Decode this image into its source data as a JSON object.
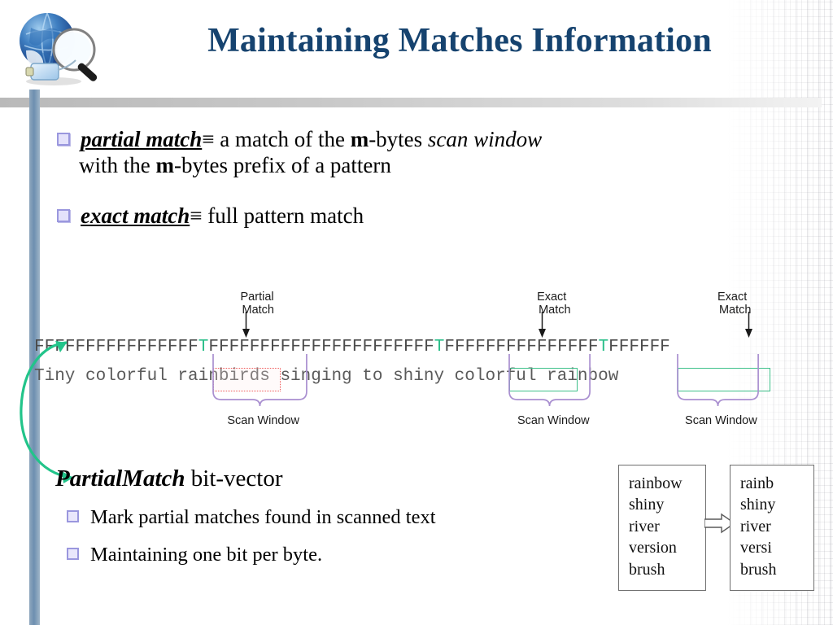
{
  "slide": {
    "title": "Maintaining Matches Information",
    "title_color": "#16436f",
    "logo_name": "globe-magnifier-logo"
  },
  "bullets": [
    {
      "term": "partial match",
      "equiv": "≡",
      "line1_a": " a match of the ",
      "bold1": "m",
      "line1_b": "-bytes ",
      "italic1": "scan window",
      "line2_a": "with the ",
      "bold2": "m",
      "line2_b": "-bytes prefix of a pattern"
    },
    {
      "term": "exact match",
      "equiv": "≡",
      "rest": " full pattern match"
    }
  ],
  "diagram": {
    "bitvector": "FFFFFFFFFFFFFFFFTFFFFFFFFFFFFFFFFFFFFFFTFFFFFFFFFFFFFFFTFFFFFF",
    "text": "Tiny colorful rainbirds singing to shiny colorful rainbow",
    "true_positions": [
      16,
      39,
      55
    ],
    "windows": [
      {
        "kind": "partial",
        "callout_line1": "Partial",
        "callout_line2": "Match",
        "scan_label": "Scan Window",
        "match_text": "rainb",
        "text_start": 14,
        "text_end": 19,
        "window_start": 14,
        "window_end": 21
      },
      {
        "kind": "exact",
        "callout_line1": "Exact",
        "callout_line2": "Match",
        "scan_label": "Scan Window",
        "match_text": "shiny",
        "text_start": 37,
        "text_end": 42,
        "window_start": 37,
        "window_end": 43
      },
      {
        "kind": "exact",
        "callout_line1": "Exact",
        "callout_line2": "Match",
        "scan_label": "Scan Window",
        "match_text": "rainbow",
        "text_start": 50,
        "text_end": 57,
        "window_start": 50,
        "window_end": 56
      }
    ],
    "partial_color": "#ef5a5a",
    "exact_color": "#3ec08a",
    "window_color": "#a98fd0",
    "true_bit_color": "#2bbf8a"
  },
  "lower": {
    "heading_bold": "PartialMatch",
    "heading_rest": " bit-vector",
    "sub_items": [
      "Mark partial matches found in scanned text",
      "Maintaining one bit per byte."
    ]
  },
  "wordlists": {
    "left": [
      "rainbow",
      "shiny",
      "river",
      "version",
      "brush"
    ],
    "right": [
      "rainb",
      "shiny",
      "river",
      "versi",
      "brush"
    ],
    "arrow_name": "right-arrow-icon"
  }
}
